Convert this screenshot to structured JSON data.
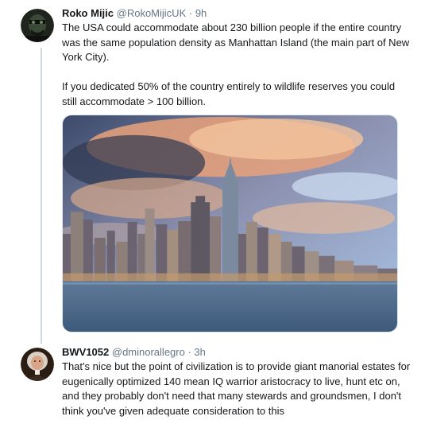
{
  "tweets": [
    {
      "author_name": "Roko Mijic",
      "handle": "@RokoMijicUK",
      "separator": " · ",
      "time": "9h",
      "lines": [
        "The USA could accommodate about 230 billion people if the entire country",
        "was the same population density as Manhattan Island (the main part of New",
        "York City).",
        "",
        "If you dedicated 50% of the country entirely to wildlife reserves you could",
        "still accommodate > 100 billion."
      ],
      "avatar_icon": "dark-portrait-avatar",
      "media_icon": "manhattan-skyline-photo"
    },
    {
      "author_name": "BWV1052",
      "handle": "@dminorallegro",
      "separator": " · ",
      "time": "3h",
      "lines": [
        "That's nice but the point of civilization is to provide giant manorial estates for",
        "eugenically optimized 140 mean IQ warrior aristocracy to live, hunt etc on,",
        "and they probably don't need that many stewards and groundsmen, I don't",
        "think you've given adequate consideration to this"
      ],
      "avatar_icon": "bach-portrait-avatar"
    }
  ],
  "colors": {
    "text": "#14171a",
    "meta": "#657786",
    "thread_line": "#cfd9de"
  }
}
